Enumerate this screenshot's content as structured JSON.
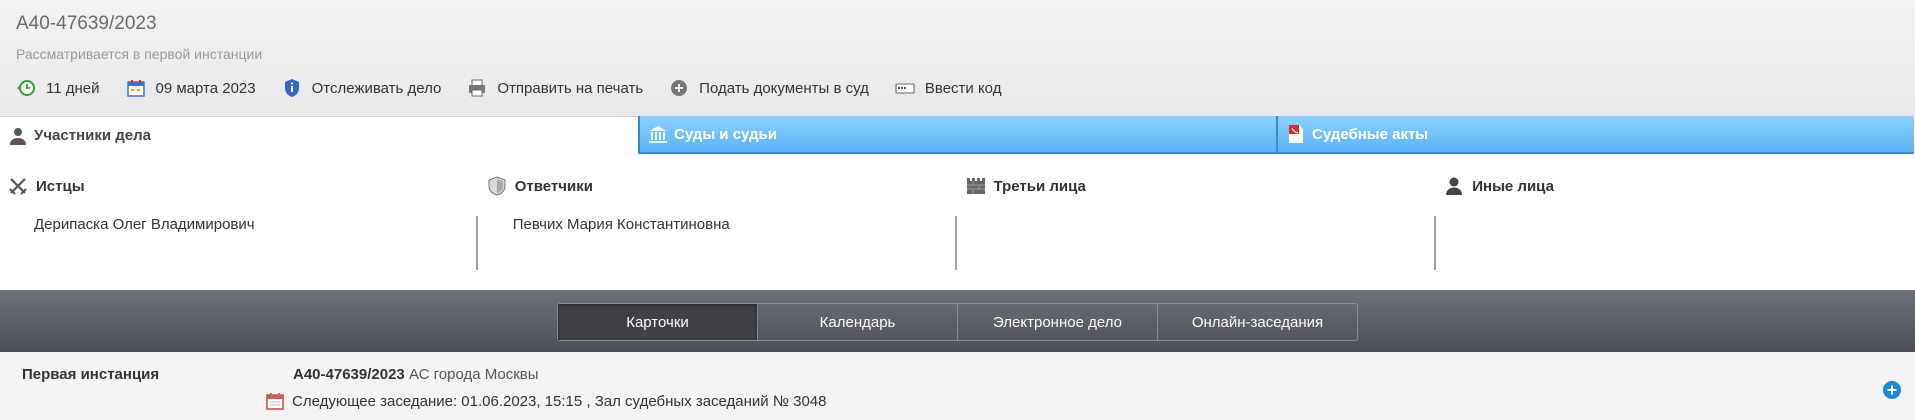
{
  "case": {
    "number": "А40-47639/2023",
    "status": "Рассматривается в первой инстанции"
  },
  "toolbar": {
    "days": "11 дней",
    "date": "09 марта 2023",
    "track": "Отслеживать дело",
    "print": "Отправить на печать",
    "submit": "Подать документы в суд",
    "code": "Ввести код"
  },
  "tabs": [
    {
      "label": "Участники дела",
      "icon": "person-icon"
    },
    {
      "label": "Суды и судьи",
      "icon": "courthouse-icon"
    },
    {
      "label": "Судебные акты",
      "icon": "pdf-icon"
    }
  ],
  "parties": {
    "plaintiffs": {
      "label": "Истцы",
      "names": [
        "Дерипаска Олег Владимирович"
      ]
    },
    "defendants": {
      "label": "Ответчики",
      "names": [
        "Певчих Мария Константиновна"
      ]
    },
    "third": {
      "label": "Третьи лица",
      "names": []
    },
    "other": {
      "label": "Иные лица",
      "names": []
    }
  },
  "nav": [
    {
      "label": "Карточки",
      "active": true
    },
    {
      "label": "Календарь",
      "active": false
    },
    {
      "label": "Электронное дело",
      "active": false
    },
    {
      "label": "Онлайн-заседания",
      "active": false
    }
  ],
  "instance": {
    "label": "Первая инстанция",
    "case_number": "А40-47639/2023",
    "court": "АС города Москвы",
    "next_hearing": "Следующее заседание: 01.06.2023, 15:15 , Зал судебных заседаний № 3048"
  },
  "colors": {
    "tab_blue": "#5cb3f5",
    "nav_dark": "#4d4f56",
    "accent_blue": "#1e88d6"
  }
}
